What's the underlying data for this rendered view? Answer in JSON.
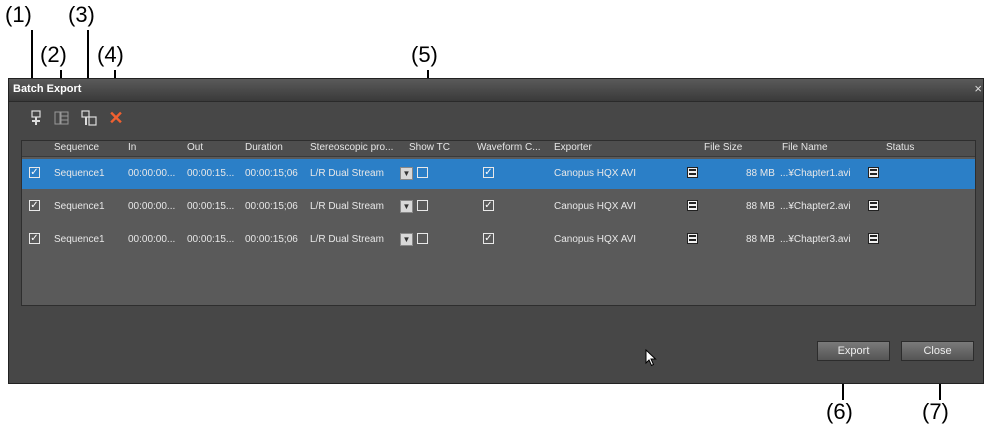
{
  "callouts": [
    "(1)",
    "(2)",
    "(3)",
    "(4)",
    "(5)",
    "(6)",
    "(7)"
  ],
  "window": {
    "title": "Batch Export",
    "close_glyph": "×"
  },
  "toolbar": {
    "icons": [
      "add-icon",
      "add-below-icon",
      "batch-add-icon",
      "delete-icon"
    ],
    "delete_glyph": "✕"
  },
  "table": {
    "headers": [
      "Sequence",
      "In",
      "Out",
      "Duration",
      "Stereoscopic pro...",
      "Show TC",
      "Waveform C...",
      "Exporter",
      "File Size",
      "File Name",
      "Status"
    ],
    "rows": [
      {
        "checked": true,
        "sequence": "Sequence1",
        "in": "00:00:00...",
        "out": "00:00:15...",
        "duration": "00:00:15;06",
        "stereo": "L/R Dual Stream",
        "show_tc": false,
        "waveform": true,
        "exporter": "Canopus HQX AVI",
        "file_size": "88 MB",
        "file_name": "...¥Chapter1.avi",
        "status": "",
        "selected": true
      },
      {
        "checked": true,
        "sequence": "Sequence1",
        "in": "00:00:00...",
        "out": "00:00:15...",
        "duration": "00:00:15;06",
        "stereo": "L/R Dual Stream",
        "show_tc": false,
        "waveform": true,
        "exporter": "Canopus HQX AVI",
        "file_size": "88 MB",
        "file_name": "...¥Chapter2.avi",
        "status": "",
        "selected": false
      },
      {
        "checked": true,
        "sequence": "Sequence1",
        "in": "00:00:00...",
        "out": "00:00:15...",
        "duration": "00:00:15;06",
        "stereo": "L/R Dual Stream",
        "show_tc": false,
        "waveform": true,
        "exporter": "Canopus HQX AVI",
        "file_size": "88 MB",
        "file_name": "...¥Chapter3.avi",
        "status": "",
        "selected": false
      }
    ]
  },
  "buttons": {
    "export": "Export",
    "close": "Close"
  },
  "colors": {
    "selection": "#2b7fc7",
    "delete_icon": "#f06030",
    "window_bg": "#474747",
    "table_bg": "#5a5a5a"
  }
}
